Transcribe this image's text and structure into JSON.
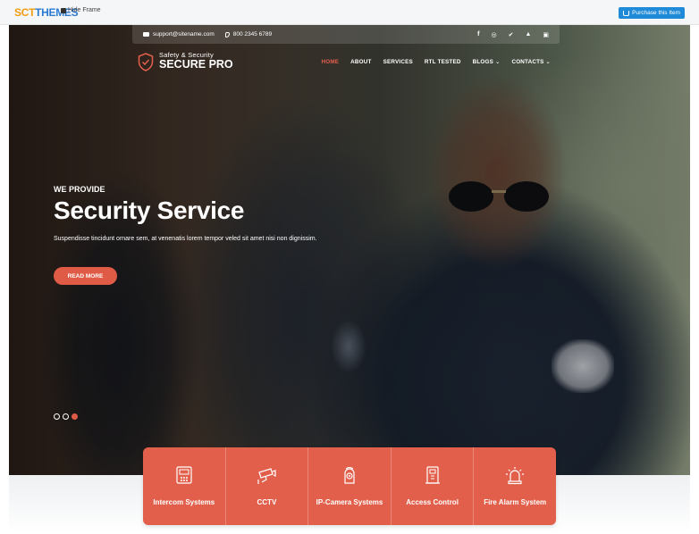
{
  "preview_bar": {
    "brand_sct": "SCT",
    "brand_themes": "THEMES",
    "hide_frame": "Hide Frame",
    "purchase": "Purchase this Item"
  },
  "contact": {
    "email": "support@sitename.com",
    "phone": "800 2345 6789",
    "social_icons": [
      "facebook-icon",
      "instagram-icon",
      "twitter-icon",
      "youtube-icon",
      "linkedin-icon"
    ],
    "social_glyphs": [
      "f",
      "◎",
      "✔",
      "▲",
      "▣"
    ]
  },
  "logo": {
    "tagline": "Safety & Security",
    "name": "SECURE PRO"
  },
  "nav": {
    "items": [
      {
        "label": "HOME",
        "active": true
      },
      {
        "label": "ABOUT"
      },
      {
        "label": "SERVICES"
      },
      {
        "label": "RTL TESTED"
      },
      {
        "label": "BLOGS ⌄"
      },
      {
        "label": "CONTACTS ⌄"
      }
    ]
  },
  "hero": {
    "subtitle": "WE PROVIDE",
    "title": "Security Service",
    "description": "Suspendisse tincidunt ornare sem, at venenatis lorem tempor veled sit amet nisi non dignissim.",
    "button": "READ MORE",
    "slides": 3,
    "active_slide": 3
  },
  "services": [
    {
      "label": "Intercom Systems",
      "icon": "intercom-icon"
    },
    {
      "label": "CCTV",
      "icon": "cctv-camera-icon"
    },
    {
      "label": "IP-Camera Systems",
      "icon": "ip-camera-icon"
    },
    {
      "label": "Access Control",
      "icon": "access-control-icon"
    },
    {
      "label": "Fire Alarm System",
      "icon": "fire-alarm-icon"
    }
  ],
  "colors": {
    "accent": "#e25f4b",
    "purchase_button": "#1f8ad8"
  }
}
